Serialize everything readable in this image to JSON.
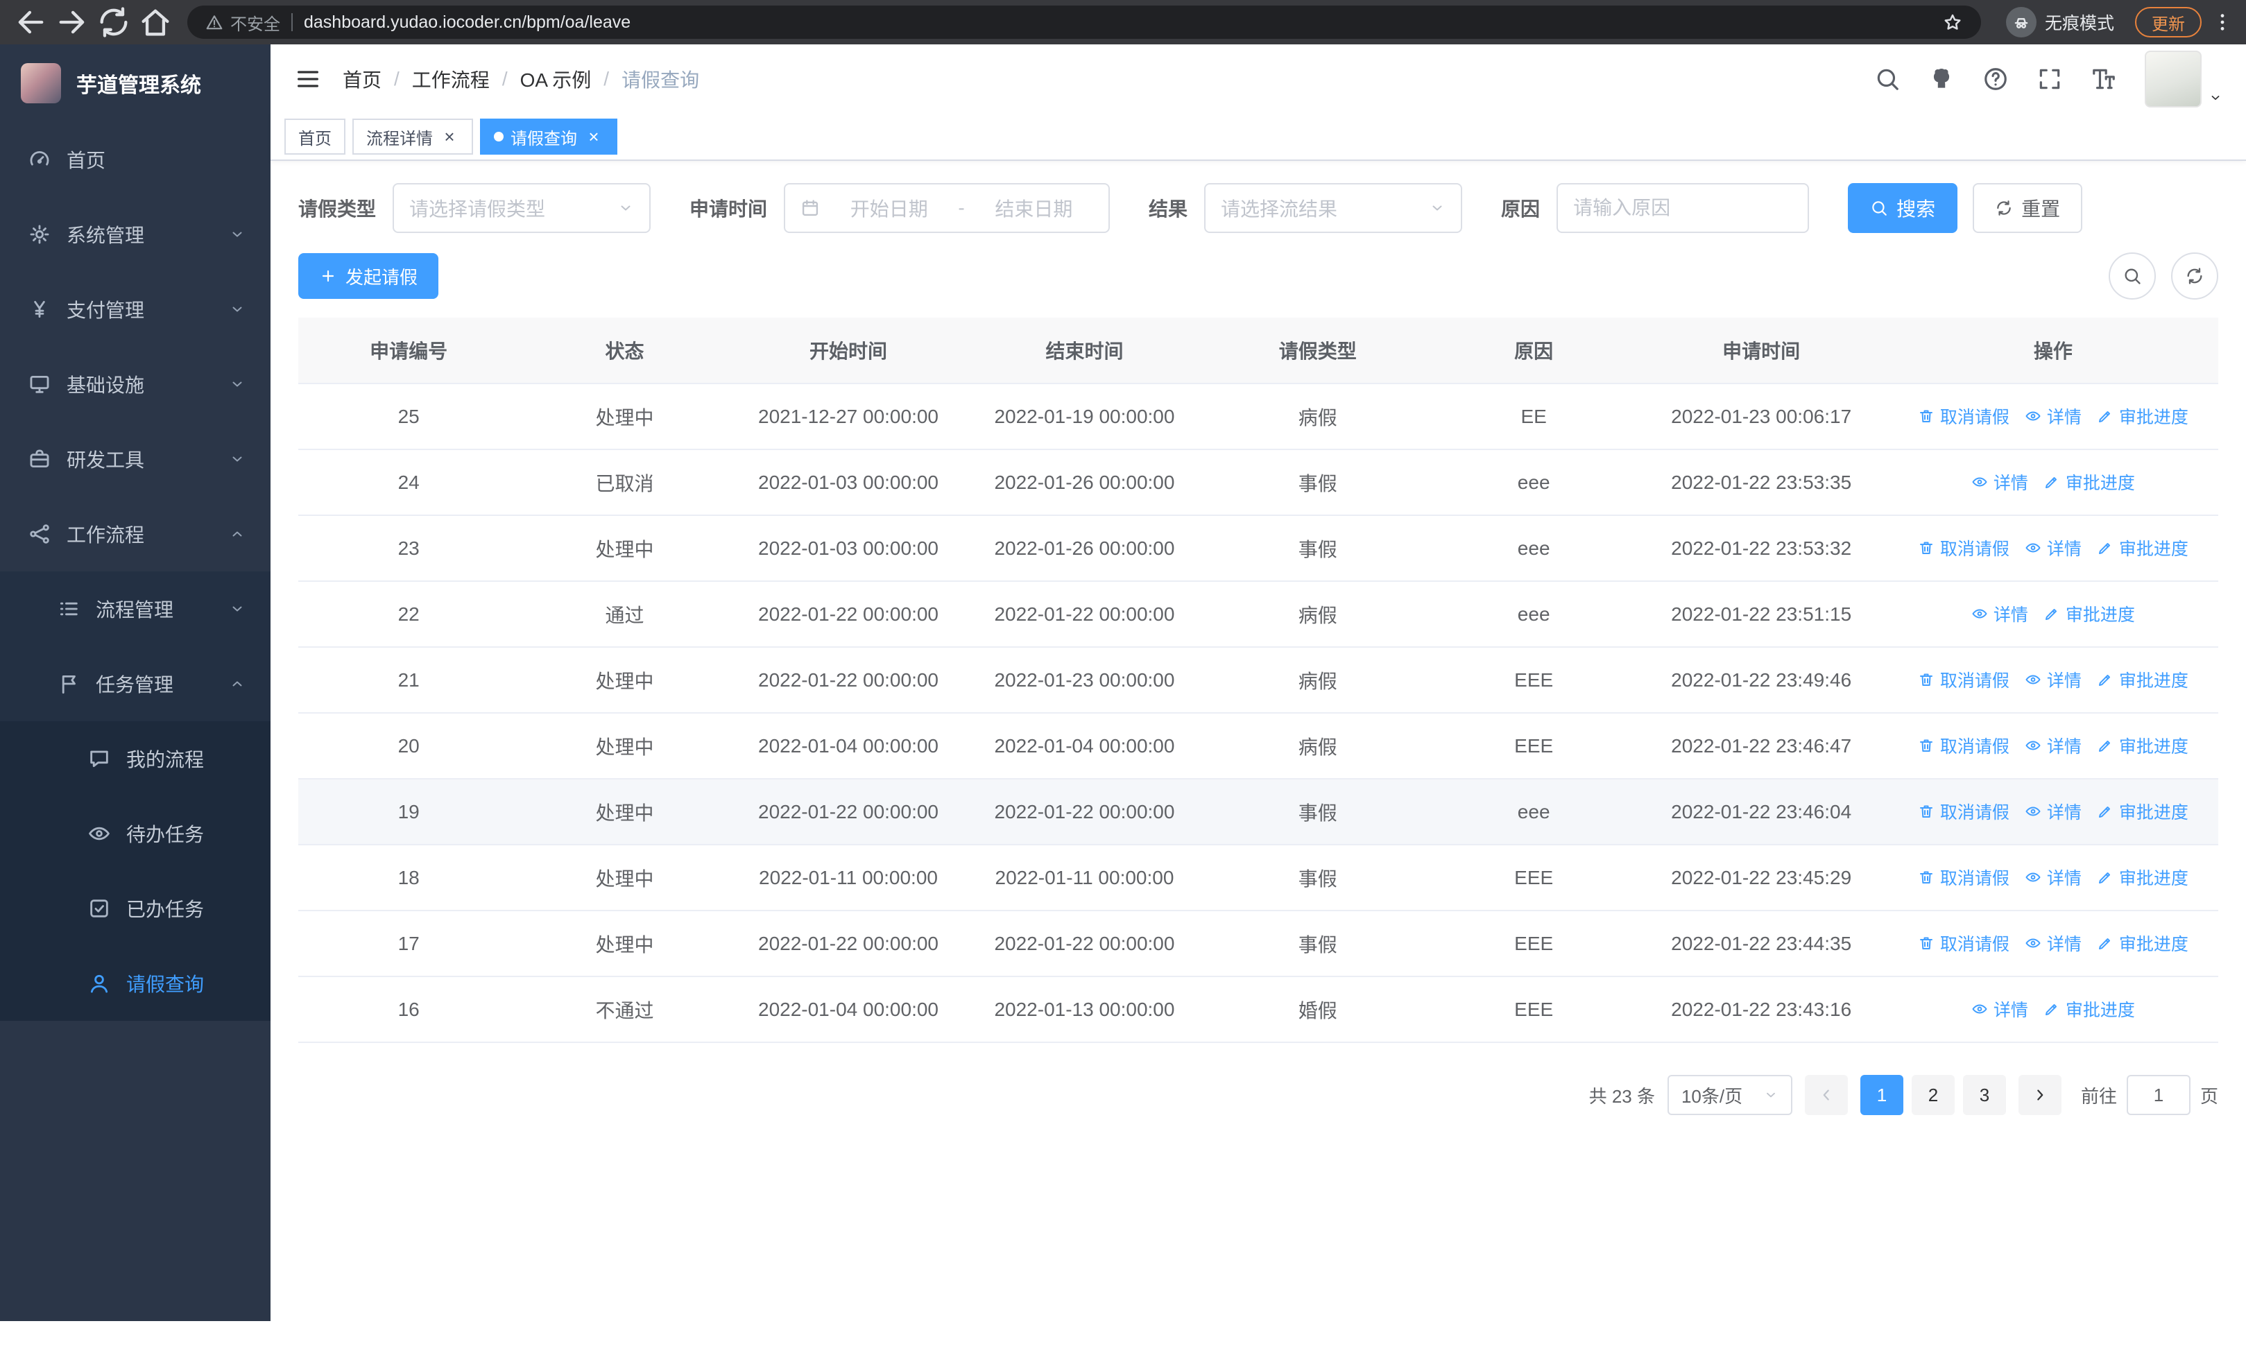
{
  "colors": {
    "accent": "#409eff",
    "sidebar_bg": "#2b3648",
    "submenu_bg": "#233043",
    "submenu_deep_bg": "#1d2a3c",
    "table_header_bg": "#f8f8f9",
    "hover_row_bg": "#f5f7fa"
  },
  "browser": {
    "nav_icons": [
      "back-icon",
      "forward-icon",
      "refresh-icon",
      "home-icon"
    ],
    "security_label": "不安全",
    "url": "dashboard.yudao.iocoder.cn/bpm/oa/leave",
    "incognito_label": "无痕模式",
    "update_label": "更新"
  },
  "sidebar": {
    "logo_title": "芋道管理系统",
    "menu": [
      {
        "label": "首页",
        "icon": "dashboard-icon"
      },
      {
        "label": "系统管理",
        "icon": "gear-icon",
        "chevron": "down"
      },
      {
        "label": "支付管理",
        "icon": "yen-icon",
        "chevron": "down"
      },
      {
        "label": "基础设施",
        "icon": "monitor-icon",
        "chevron": "down"
      },
      {
        "label": "研发工具",
        "icon": "briefcase-icon",
        "chevron": "down"
      },
      {
        "label": "工作流程",
        "icon": "workflow-icon",
        "chevron": "up",
        "expanded": true,
        "children": [
          {
            "label": "流程管理",
            "icon": "list-icon",
            "chevron": "down"
          },
          {
            "label": "任务管理",
            "icon": "tasks-icon",
            "chevron": "up",
            "expanded": true,
            "children": [
              {
                "label": "我的流程",
                "icon": "chat-icon"
              },
              {
                "label": "待办任务",
                "icon": "eye-icon"
              },
              {
                "label": "已办任务",
                "icon": "check-icon"
              },
              {
                "label": "请假查询",
                "icon": "user-icon",
                "active": true
              }
            ]
          }
        ]
      }
    ]
  },
  "header": {
    "breadcrumb": [
      "首页",
      "工作流程",
      "OA 示例",
      "请假查询"
    ],
    "tools": [
      "search-icon",
      "github-icon",
      "question-icon",
      "fullscreen-icon",
      "fontsize-icon"
    ]
  },
  "tabs": [
    {
      "label": "首页",
      "closable": false,
      "active": false
    },
    {
      "label": "流程详情",
      "closable": true,
      "active": false
    },
    {
      "label": "请假查询",
      "closable": true,
      "active": true
    }
  ],
  "filters": {
    "leave_type_label": "请假类型",
    "leave_type_placeholder": "请选择请假类型",
    "apply_time_label": "申请时间",
    "date_start_placeholder": "开始日期",
    "date_separator": "-",
    "date_end_placeholder": "结束日期",
    "result_label": "结果",
    "result_placeholder": "请选择流结果",
    "reason_label": "原因",
    "reason_placeholder": "请输入原因",
    "search_button": "搜索",
    "reset_button": "重置"
  },
  "toolbar": {
    "create_button": "发起请假",
    "tools": [
      "search-icon",
      "refresh-icon"
    ]
  },
  "table": {
    "columns": [
      "申请编号",
      "状态",
      "开始时间",
      "结束时间",
      "请假类型",
      "原因",
      "申请时间",
      "操作"
    ],
    "action_defs": {
      "cancel": {
        "label": "取消请假",
        "icon": "trash-icon"
      },
      "detail": {
        "label": "详情",
        "icon": "eye-icon"
      },
      "progress": {
        "label": "审批进度",
        "icon": "edit-icon"
      }
    },
    "rows": [
      {
        "no": "25",
        "status": "处理中",
        "start": "2021-12-27 00:00:00",
        "end": "2022-01-19 00:00:00",
        "type": "病假",
        "reason": "EE",
        "applied": "2022-01-23 00:06:17",
        "actions": [
          "cancel",
          "detail",
          "progress"
        ]
      },
      {
        "no": "24",
        "status": "已取消",
        "start": "2022-01-03 00:00:00",
        "end": "2022-01-26 00:00:00",
        "type": "事假",
        "reason": "eee",
        "applied": "2022-01-22 23:53:35",
        "actions": [
          "detail",
          "progress"
        ]
      },
      {
        "no": "23",
        "status": "处理中",
        "start": "2022-01-03 00:00:00",
        "end": "2022-01-26 00:00:00",
        "type": "事假",
        "reason": "eee",
        "applied": "2022-01-22 23:53:32",
        "actions": [
          "cancel",
          "detail",
          "progress"
        ]
      },
      {
        "no": "22",
        "status": "通过",
        "start": "2022-01-22 00:00:00",
        "end": "2022-01-22 00:00:00",
        "type": "病假",
        "reason": "eee",
        "applied": "2022-01-22 23:51:15",
        "actions": [
          "detail",
          "progress"
        ]
      },
      {
        "no": "21",
        "status": "处理中",
        "start": "2022-01-22 00:00:00",
        "end": "2022-01-23 00:00:00",
        "type": "病假",
        "reason": "EEE",
        "applied": "2022-01-22 23:49:46",
        "actions": [
          "cancel",
          "detail",
          "progress"
        ]
      },
      {
        "no": "20",
        "status": "处理中",
        "start": "2022-01-04 00:00:00",
        "end": "2022-01-04 00:00:00",
        "type": "病假",
        "reason": "EEE",
        "applied": "2022-01-22 23:46:47",
        "actions": [
          "cancel",
          "detail",
          "progress"
        ]
      },
      {
        "no": "19",
        "status": "处理中",
        "start": "2022-01-22 00:00:00",
        "end": "2022-01-22 00:00:00",
        "type": "事假",
        "reason": "eee",
        "applied": "2022-01-22 23:46:04",
        "actions": [
          "cancel",
          "detail",
          "progress"
        ],
        "highlight": true
      },
      {
        "no": "18",
        "status": "处理中",
        "start": "2022-01-11 00:00:00",
        "end": "2022-01-11 00:00:00",
        "type": "事假",
        "reason": "EEE",
        "applied": "2022-01-22 23:45:29",
        "actions": [
          "cancel",
          "detail",
          "progress"
        ]
      },
      {
        "no": "17",
        "status": "处理中",
        "start": "2022-01-22 00:00:00",
        "end": "2022-01-22 00:00:00",
        "type": "事假",
        "reason": "EEE",
        "applied": "2022-01-22 23:44:35",
        "actions": [
          "cancel",
          "detail",
          "progress"
        ]
      },
      {
        "no": "16",
        "status": "不通过",
        "start": "2022-01-04 00:00:00",
        "end": "2022-01-13 00:00:00",
        "type": "婚假",
        "reason": "EEE",
        "applied": "2022-01-22 23:43:16",
        "actions": [
          "detail",
          "progress"
        ]
      }
    ]
  },
  "pagination": {
    "total": "共 23 条",
    "page_size": "10条/页",
    "pages": [
      "1",
      "2",
      "3"
    ],
    "active_page": "1",
    "goto_label": "前往",
    "goto_value": "1",
    "page_label": "页"
  }
}
